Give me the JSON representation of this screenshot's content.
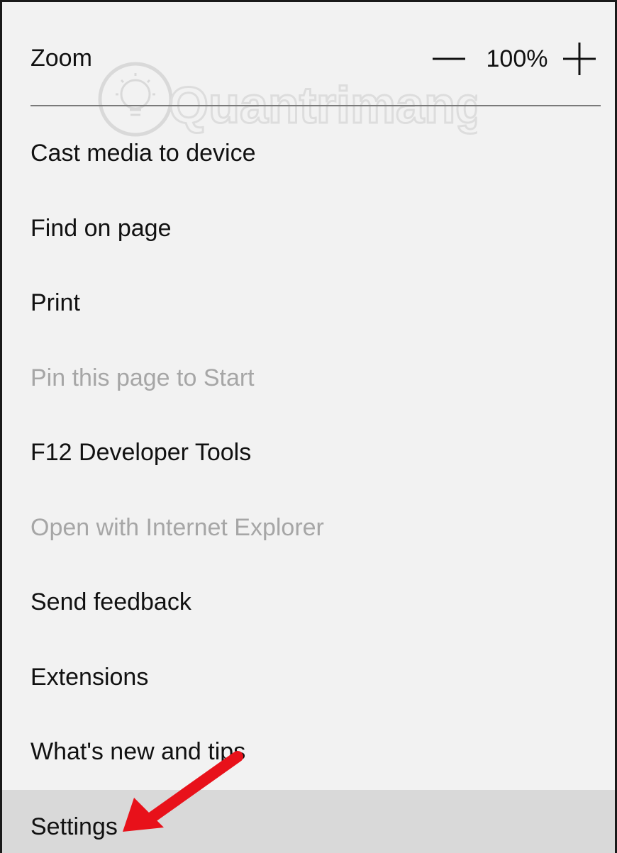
{
  "zoom": {
    "label": "Zoom",
    "value": "100%",
    "decrease_icon": "minus-icon",
    "increase_icon": "plus-icon"
  },
  "watermark": {
    "text": "Quantrimang",
    "icon": "lightbulb-icon"
  },
  "menu_items": [
    {
      "label": "Cast media to device",
      "enabled": true
    },
    {
      "label": "Find on page",
      "enabled": true
    },
    {
      "label": "Print",
      "enabled": true
    },
    {
      "label": "Pin this page to Start",
      "enabled": false
    },
    {
      "label": "F12 Developer Tools",
      "enabled": true
    },
    {
      "label": "Open with Internet Explorer",
      "enabled": false
    },
    {
      "label": "Send feedback",
      "enabled": true
    },
    {
      "label": "Extensions",
      "enabled": true
    },
    {
      "label": "What's new and tips",
      "enabled": true
    },
    {
      "label": "Settings",
      "enabled": true,
      "highlighted": true
    }
  ],
  "annotation": {
    "icon": "red-arrow-icon",
    "color": "#e8111a"
  },
  "colors": {
    "background": "#f2f2f2",
    "highlight": "#d9d9d9",
    "disabled_text": "#a6a6a6",
    "text": "#111111"
  }
}
